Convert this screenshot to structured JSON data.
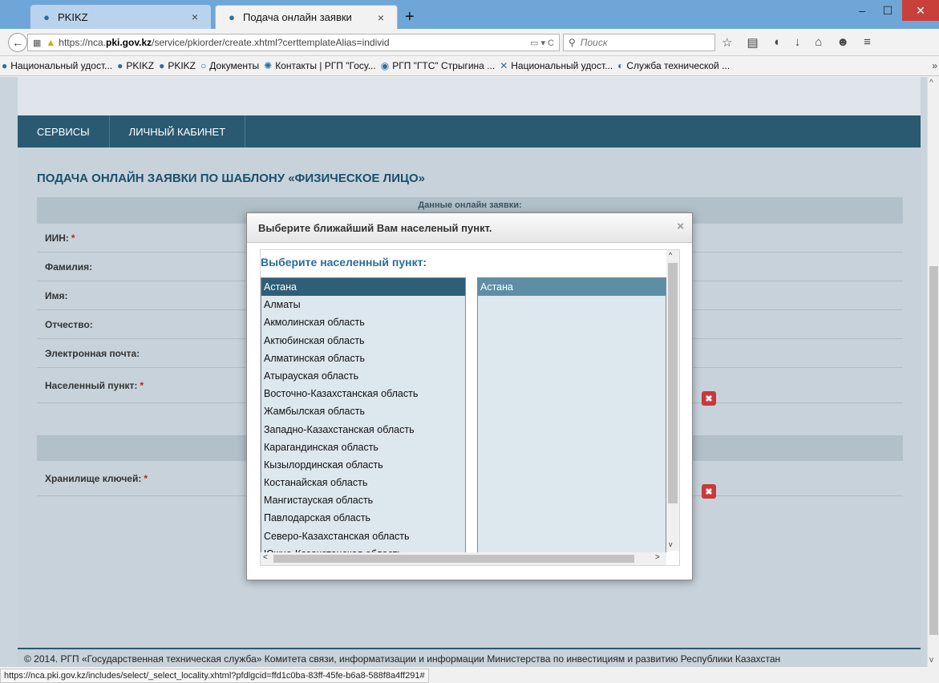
{
  "browser": {
    "tabs": [
      {
        "title": "PKIKZ"
      },
      {
        "title": "Подача онлайн заявки"
      }
    ],
    "new_tab": "+",
    "url_prefix": "https://nca.",
    "url_domain": "pki.gov.kz",
    "url_rest": "/service/pkiorder/create.xhtml?certtemplateAlias=individ",
    "search_placeholder": "Поиск",
    "bookmarks": [
      "Национальный удост...",
      "PKIKZ",
      "PKIKZ",
      "Документы",
      "Контакты | РГП \"Госу...",
      "РГП \"ГТС\" Стрыгина ...",
      "Национальный удост...",
      "Служба технической ..."
    ],
    "bookmarks_more": "»",
    "status_url": "https://nca.pki.gov.kz/includes/select/_select_locality.xhtml?pfdlgcid=ffd1c0ba-83ff-45fe-b6a8-588f8a4ff291#"
  },
  "site": {
    "nav": [
      "СЕРВИСЫ",
      "ЛИЧНЫЙ КАБИНЕТ"
    ],
    "page_title": "ПОДАЧА ОНЛАЙН ЗАЯВКИ ПО ШАБЛОНУ «ФИЗИЧЕСКОЕ ЛИЦО»",
    "form_header": "Данные онлайн заявки:",
    "fields": {
      "iin": "ИИН:",
      "surname": "Фамилия:",
      "name": "Имя:",
      "patronymic": "Отчество:",
      "email": "Электронная почта:",
      "locality": "Населенный пункт:",
      "keystore": "Хранилище ключей:"
    },
    "required_mark": "*",
    "clear_icon": "✖",
    "footer": "© 2014. РГП «Государственная техническая служба» Комитета связи, информатизации и информации Министерства по инвестициям и развитию Республики Казахстан"
  },
  "modal": {
    "title": "Выберите ближайший Вам населеный пункт.",
    "close": "×",
    "label": "Выберите населенный пункт:",
    "regions": [
      "Астана",
      "Алматы",
      "Акмолинская область",
      "Актюбинская область",
      "Алматинская область",
      "Атырауская область",
      "Восточно-Казахстанская область",
      "Жамбылская область",
      "Западно-Казахстанская область",
      "Карагандинская область",
      "Кызылординская область",
      "Костанайская область",
      "Мангистауская область",
      "Павлодарская область",
      "Северо-Казахстанская область",
      "Южно-Казахстанская область"
    ],
    "selected_region": "Астана",
    "localities": [
      "Астана"
    ]
  }
}
